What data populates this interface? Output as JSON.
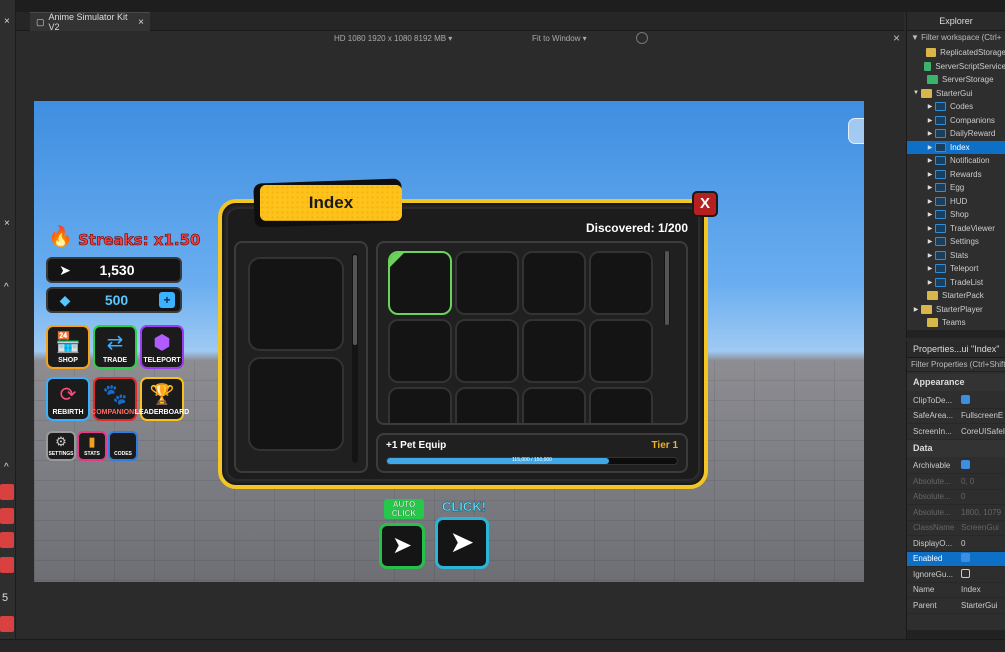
{
  "document_tab": {
    "title": "Anime Simulator Kit V2",
    "close": "×"
  },
  "viewport_bar": {
    "resolution": "HD 1080    1920 x 1080    8192 MB  ▾",
    "fit": "Fit to Window  ▾",
    "close": "×"
  },
  "hud": {
    "streaks": "Streaks: x1.50",
    "clicks": "1,530",
    "gems": "500",
    "gems_plus": "+",
    "buttons": [
      {
        "label": "SHOP",
        "icon": "shop-icon",
        "color": "#f7a21b"
      },
      {
        "label": "TRADE",
        "icon": "trade-icon",
        "color": "#2fcf4c"
      },
      {
        "label": "TELEPORT",
        "icon": "teleport-icon",
        "color": "#9b3cf0"
      },
      {
        "label": "REBIRTH",
        "icon": "rebirth-icon",
        "color": "#3ab0ff"
      },
      {
        "label": "COMPANIONS",
        "icon": "paw-icon",
        "color": "#e02b2b"
      },
      {
        "label": "LEADERBOARD",
        "icon": "trophy-icon",
        "color": "#f7c21b"
      }
    ],
    "small_buttons": [
      {
        "label": "SETTINGS",
        "icon": "gear-icon",
        "color": "#bdbdbd"
      },
      {
        "label": "STATS",
        "icon": "stats-icon",
        "color": "#e8388a"
      },
      {
        "label": "CODES",
        "icon": "codes-icon",
        "color": "#2f7de0"
      }
    ]
  },
  "index_panel": {
    "title": "Index",
    "close": "X",
    "discovered": "Discovered: 1/200",
    "equip_label": "+1 Pet Equip",
    "tier_label": "Tier 1",
    "progress_text": "115,000 / 150,000",
    "progress_fraction": 0.766
  },
  "click_buttons": {
    "auto_click": "AUTO CLICK",
    "click": "CLICK!"
  },
  "explorer": {
    "title": "Explorer",
    "filter": "Filter workspace (Ctrl+",
    "items": [
      {
        "label": "ReplicatedStorage",
        "icon": "folder",
        "depth": 1,
        "arrow": ""
      },
      {
        "label": "ServerScriptService",
        "icon": "script",
        "depth": 1,
        "arrow": ""
      },
      {
        "label": "ServerStorage",
        "icon": "script",
        "depth": 1,
        "arrow": ""
      },
      {
        "label": "StarterGui",
        "icon": "folder",
        "depth": 0,
        "arrow": "▼"
      },
      {
        "label": "Codes",
        "icon": "gui",
        "depth": 2,
        "arrow": "▶"
      },
      {
        "label": "Companions",
        "icon": "gui",
        "depth": 2,
        "arrow": "▶"
      },
      {
        "label": "DailyReward",
        "icon": "gui",
        "depth": 2,
        "arrow": "▶"
      },
      {
        "label": "Index",
        "icon": "gui",
        "depth": 2,
        "arrow": "▶",
        "selected": true
      },
      {
        "label": "Notification",
        "icon": "gui",
        "depth": 2,
        "arrow": "▶"
      },
      {
        "label": "Rewards",
        "icon": "gui",
        "depth": 2,
        "arrow": "▶"
      },
      {
        "label": "Egg",
        "icon": "gui",
        "depth": 2,
        "arrow": "▶"
      },
      {
        "label": "HUD",
        "icon": "gui",
        "depth": 2,
        "arrow": "▶"
      },
      {
        "label": "Shop",
        "icon": "gui",
        "depth": 2,
        "arrow": "▶"
      },
      {
        "label": "TradeViewer",
        "icon": "gui",
        "depth": 2,
        "arrow": "▶"
      },
      {
        "label": "Settings",
        "icon": "gui",
        "depth": 2,
        "arrow": "▶"
      },
      {
        "label": "Stats",
        "icon": "gui",
        "depth": 2,
        "arrow": "▶"
      },
      {
        "label": "Teleport",
        "icon": "gui",
        "depth": 2,
        "arrow": "▶"
      },
      {
        "label": "TradeList",
        "icon": "gui",
        "depth": 2,
        "arrow": "▶"
      },
      {
        "label": "StarterPack",
        "icon": "folder",
        "depth": 1,
        "arrow": ""
      },
      {
        "label": "StarterPlayer",
        "icon": "folder",
        "depth": 0,
        "arrow": "▶"
      },
      {
        "label": "Teams",
        "icon": "folder",
        "depth": 1,
        "arrow": ""
      }
    ]
  },
  "properties": {
    "title": "Properties...ui \"Index\"",
    "filter": "Filter Properties (Ctrl+Shift",
    "sections": [
      {
        "name": "Appearance",
        "rows": [
          {
            "name": "ClipToDe...",
            "value": "",
            "check": "on"
          },
          {
            "name": "SafeArea...",
            "value": "FullscreenE"
          },
          {
            "name": "ScreenIn...",
            "value": "CoreUISafeI"
          }
        ]
      },
      {
        "name": "Data",
        "rows": [
          {
            "name": "Archivable",
            "value": "",
            "check": "on"
          },
          {
            "name": "Absolute...",
            "value": "0, 0",
            "dim": true
          },
          {
            "name": "Absolute...",
            "value": "0",
            "dim": true
          },
          {
            "name": "Absolute...",
            "value": "1800, 1079",
            "dim": true
          },
          {
            "name": "ClassName",
            "value": "ScreenGui",
            "dim": true
          },
          {
            "name": "DisplayO...",
            "value": "0"
          },
          {
            "name": "Enabled",
            "value": "",
            "check": "on",
            "selected": true
          },
          {
            "name": "IgnoreGu...",
            "value": "",
            "check": "off"
          },
          {
            "name": "Name",
            "value": "Index"
          },
          {
            "name": "Parent",
            "value": "StarterGui"
          }
        ]
      }
    ]
  },
  "left_strip": {
    "number": "5"
  }
}
